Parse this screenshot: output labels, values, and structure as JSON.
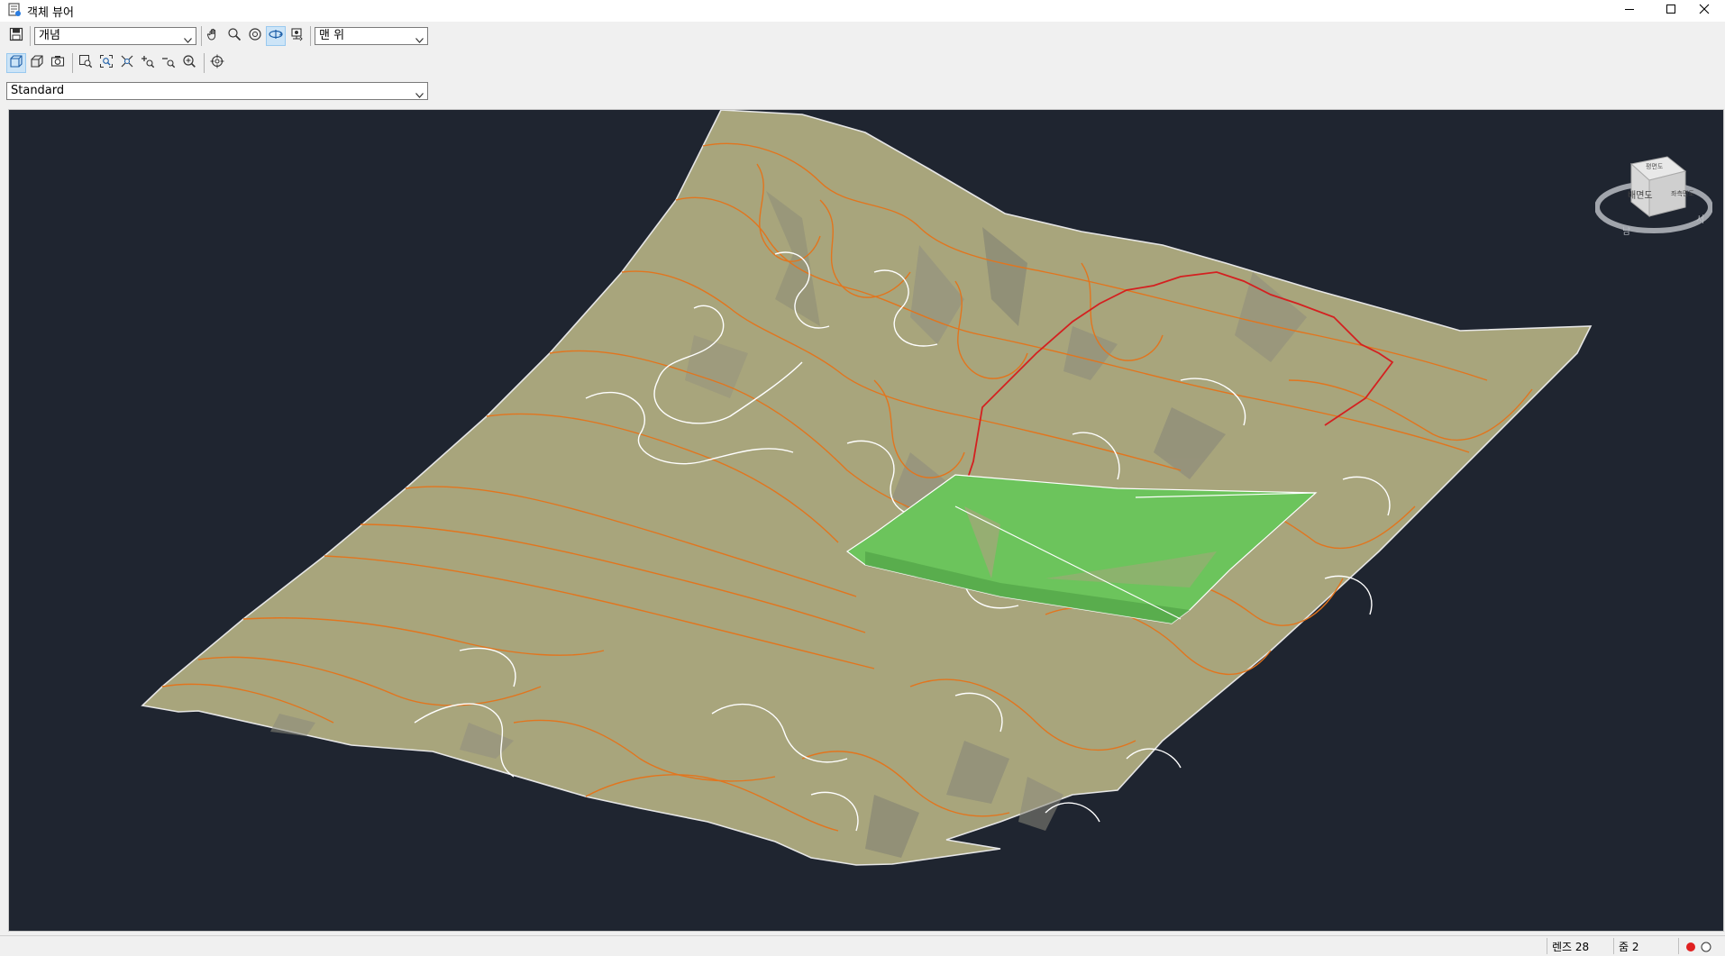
{
  "window": {
    "title": "객체 뷰어",
    "app_icon": "object-viewer-icon",
    "controls": [
      "minimize-icon",
      "maximize-icon",
      "close-icon"
    ]
  },
  "toolbar": {
    "save_icon": "save-icon",
    "visual_style_value": "개념",
    "tools": [
      "pan-icon",
      "zoom-icon",
      "orbit-icon",
      "free-orbit-icon",
      "continuous-orbit-icon"
    ],
    "view_value": "맨 위",
    "view_tools": [
      "parallel-projection-icon",
      "perspective-icon",
      "camera-icon",
      "zoom-window-icon",
      "zoom-extents-icon",
      "zoom-all-icon",
      "zoom-in-icon",
      "zoom-out-icon",
      "zoom-realtime-icon",
      "target-icon"
    ]
  },
  "style_dropdown": {
    "value": "Standard"
  },
  "viewcube": {
    "face_label": "배면도",
    "top_label": "평면도",
    "side_label": "좌측면도",
    "compass_labels": [
      "서",
      "남"
    ]
  },
  "statusbar": {
    "left_value": "렌즈 28",
    "right_value": "줌 2"
  },
  "colors": {
    "viewport_bg": "#1f2530",
    "terrain": "#a8a57c",
    "contour": "#e2751e",
    "ridge": "#ffffff",
    "boundary": "#d42020",
    "pad": "#6cc45c"
  }
}
